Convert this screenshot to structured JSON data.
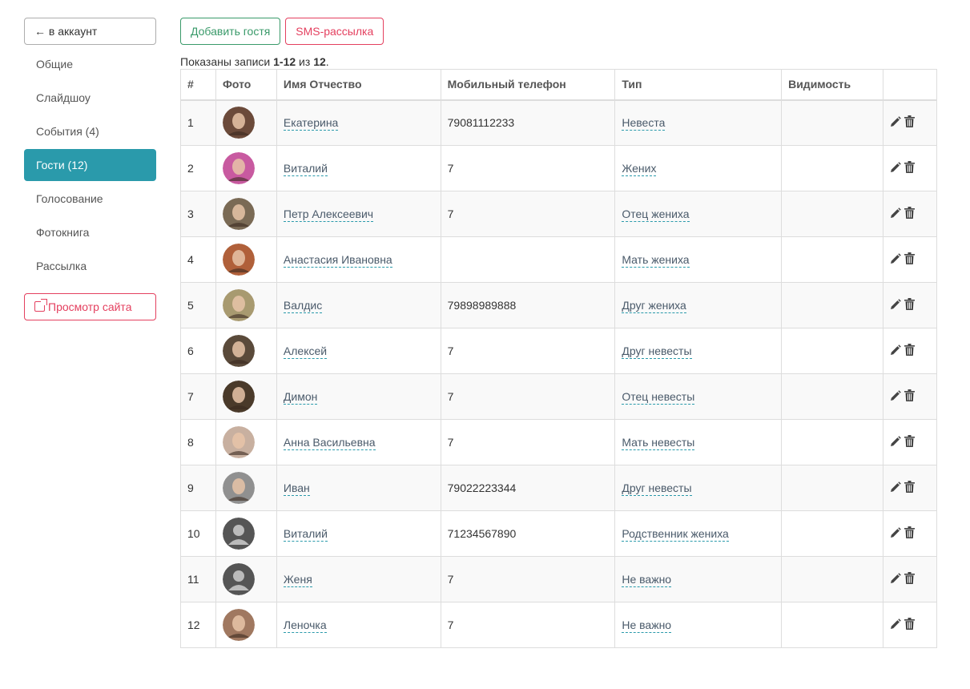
{
  "sidebar": {
    "back_label": "← в аккаунт",
    "items": [
      {
        "label": "Общие",
        "active": false
      },
      {
        "label": "Слайдшоу",
        "active": false
      },
      {
        "label": "События (4)",
        "active": false
      },
      {
        "label": "Гости (12)",
        "active": true
      },
      {
        "label": "Голосование",
        "active": false
      },
      {
        "label": "Фотокнига",
        "active": false
      },
      {
        "label": "Рассылка",
        "active": false
      }
    ],
    "view_site_label": "Просмотр сайта"
  },
  "toolbar": {
    "add_guest_label": "Добавить гостя",
    "sms_label": "SMS-рассылка"
  },
  "summary": {
    "prefix": "Показаны записи ",
    "range": "1-12",
    "middle": " из ",
    "total": "12",
    "suffix": "."
  },
  "table": {
    "headers": [
      "#",
      "Фото",
      "Имя Отчество",
      "Мобильный телефон",
      "Тип",
      "Видимость",
      ""
    ],
    "rows": [
      {
        "num": "1",
        "name": "Екатерина",
        "phone": "79081112233",
        "type": "Невеста",
        "visibility": "",
        "avatar": "photo"
      },
      {
        "num": "2",
        "name": "Виталий",
        "phone": "7",
        "type": "Жених",
        "visibility": "",
        "avatar": "photo"
      },
      {
        "num": "3",
        "name": "Петр Алексеевич",
        "phone": "7",
        "type": "Отец жениха",
        "visibility": "",
        "avatar": "photo"
      },
      {
        "num": "4",
        "name": "Анастасия Ивановна",
        "phone": "",
        "type": "Мать жениха",
        "visibility": "",
        "avatar": "photo"
      },
      {
        "num": "5",
        "name": "Валдис",
        "phone": "79898989888",
        "type": "Друг жениха",
        "visibility": "",
        "avatar": "photo"
      },
      {
        "num": "6",
        "name": "Алексей",
        "phone": "7",
        "type": "Друг невесты",
        "visibility": "",
        "avatar": "photo"
      },
      {
        "num": "7",
        "name": "Димон",
        "phone": "7",
        "type": "Отец невесты",
        "visibility": "",
        "avatar": "photo"
      },
      {
        "num": "8",
        "name": "Анна Васильевна",
        "phone": "7",
        "type": "Мать невесты",
        "visibility": "",
        "avatar": "photo"
      },
      {
        "num": "9",
        "name": "Иван",
        "phone": "79022223344",
        "type": "Друг невесты",
        "visibility": "",
        "avatar": "photo"
      },
      {
        "num": "10",
        "name": "Виталий",
        "phone": "71234567890",
        "type": "Родственник жениха",
        "visibility": "",
        "avatar": "placeholder"
      },
      {
        "num": "11",
        "name": "Женя",
        "phone": "7",
        "type": "Не важно",
        "visibility": "",
        "avatar": "placeholder"
      },
      {
        "num": "12",
        "name": "Леночка",
        "phone": "7",
        "type": "Не важно",
        "visibility": "",
        "avatar": "photo"
      }
    ]
  },
  "icons": {
    "edit": "pencil-icon",
    "delete": "trash-icon",
    "external": "external-link-icon"
  },
  "colors": {
    "accent": "#2a9aab",
    "add_button": "#3a9a6a",
    "danger": "#e4405f"
  }
}
